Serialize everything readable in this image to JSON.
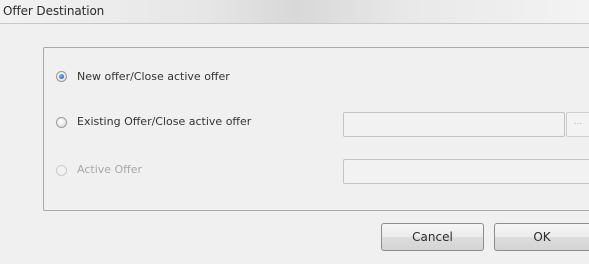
{
  "window": {
    "title": "Offer Destination"
  },
  "options": [
    {
      "label": "New offer/Close active offer",
      "selected": true,
      "enabled": true
    },
    {
      "label": "Existing Offer/Close active offer",
      "selected": false,
      "enabled": true
    },
    {
      "label": "Active Offer",
      "selected": false,
      "enabled": false
    }
  ],
  "fields": {
    "existing_offer_value": "",
    "browse_label": "...",
    "active_offer_value": ""
  },
  "buttons": {
    "cancel": "Cancel",
    "ok": "OK"
  }
}
